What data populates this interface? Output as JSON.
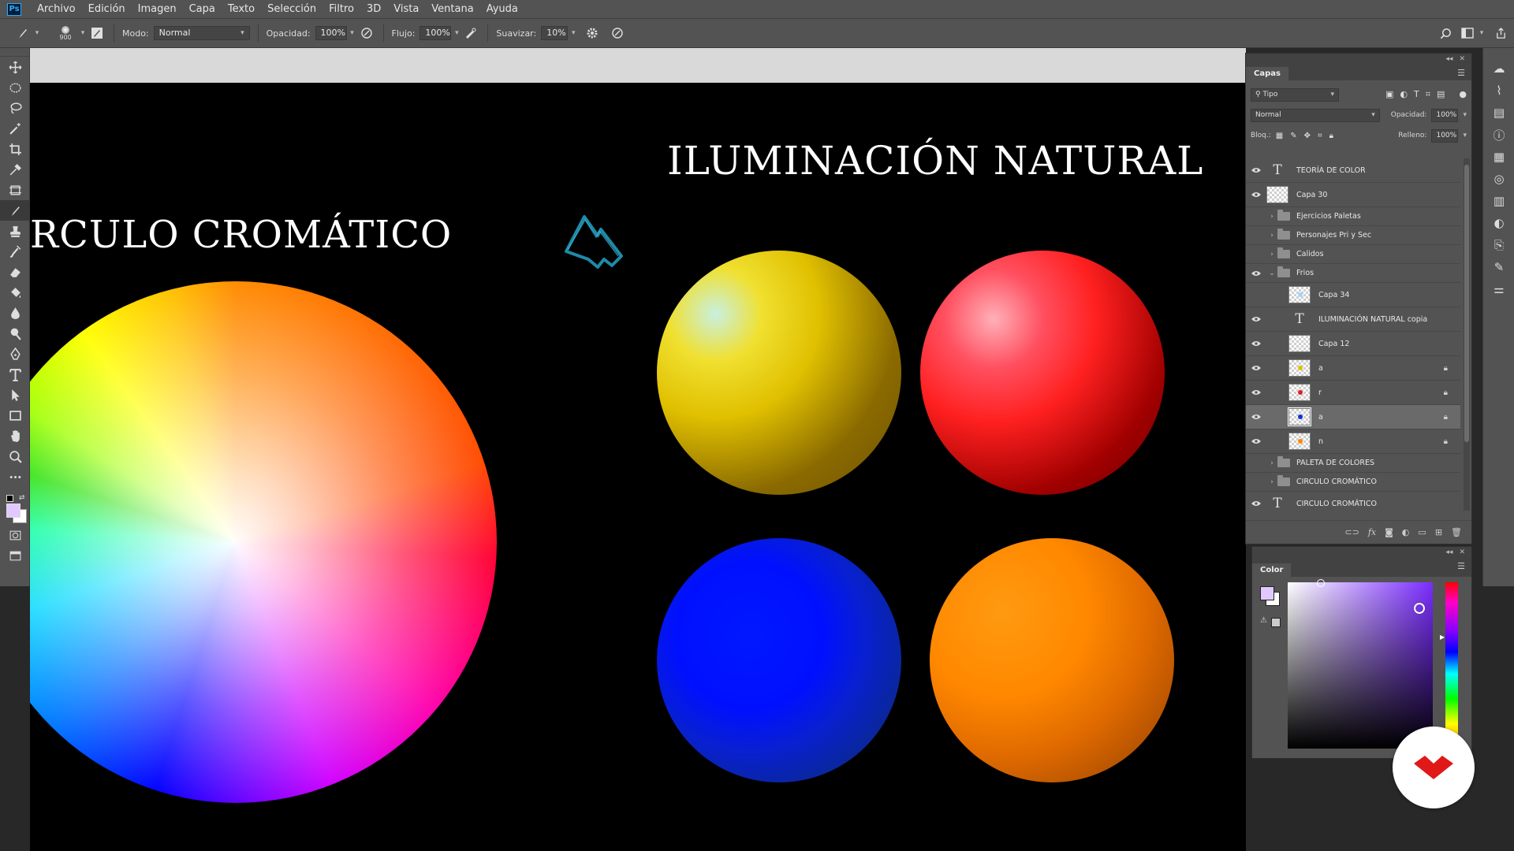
{
  "menubar": {
    "logo": "Ps",
    "items": [
      "Archivo",
      "Edición",
      "Imagen",
      "Capa",
      "Texto",
      "Selección",
      "Filtro",
      "3D",
      "Vista",
      "Ventana",
      "Ayuda"
    ]
  },
  "options": {
    "brush_size": "900",
    "mode_label": "Modo:",
    "mode_value": "Normal",
    "opacity_label": "Opacidad:",
    "opacity_value": "100%",
    "flow_label": "Flujo:",
    "flow_value": "100%",
    "smoothing_label": "Suavizar:",
    "smoothing_value": "10%"
  },
  "canvas": {
    "title_left": "RCULO CROMÁTICO",
    "title_right": "ILUMINACIÓN NATURAL",
    "sphere_colors": [
      "#e0c000",
      "#ff2020",
      "#0010ff",
      "#ff8800"
    ]
  },
  "layers_panel": {
    "tab": "Capas",
    "filter_value": "Tipo",
    "blend_mode": "Normal",
    "opacity_label": "Opacidad:",
    "opacity_value": "100%",
    "lock_label": "Bloq.:",
    "fill_label": "Relleno:",
    "fill_value": "100%",
    "layers": [
      {
        "name": "TEORÍA DE COLOR",
        "kind": "text",
        "visible": true,
        "indent": 0
      },
      {
        "name": "Capa 30",
        "kind": "pixel",
        "visible": true,
        "indent": 0
      },
      {
        "name": "Ejercicios Paletas",
        "kind": "group",
        "visible": false,
        "expanded": false,
        "indent": 0
      },
      {
        "name": "Personajes Pri y Sec",
        "kind": "group",
        "visible": false,
        "expanded": false,
        "indent": 0
      },
      {
        "name": "Calidos",
        "kind": "group",
        "visible": false,
        "expanded": false,
        "indent": 0
      },
      {
        "name": "Frios",
        "kind": "group",
        "visible": true,
        "expanded": true,
        "indent": 0
      },
      {
        "name": "Capa 34",
        "kind": "pixel",
        "visible": false,
        "indent": 1,
        "dot": "#9fd6ff"
      },
      {
        "name": "ILUMINACIÓN NATURAL copia",
        "kind": "text",
        "visible": true,
        "indent": 1
      },
      {
        "name": "Capa 12",
        "kind": "pixel",
        "visible": true,
        "indent": 1
      },
      {
        "name": "a",
        "kind": "pixel",
        "visible": true,
        "indent": 1,
        "locked": true,
        "dot": "#e0c000"
      },
      {
        "name": "r",
        "kind": "pixel",
        "visible": true,
        "indent": 1,
        "locked": true,
        "dot": "#e02020"
      },
      {
        "name": "a",
        "kind": "pixel",
        "visible": true,
        "indent": 1,
        "locked": true,
        "selected": true,
        "dot": "#1030d0"
      },
      {
        "name": "n",
        "kind": "pixel",
        "visible": true,
        "indent": 1,
        "locked": true,
        "dot": "#ff8800"
      },
      {
        "name": "PALETA DE COLORES",
        "kind": "group",
        "visible": false,
        "expanded": false,
        "indent": 0
      },
      {
        "name": "CIRCULO CROMÁTICO",
        "kind": "group",
        "visible": false,
        "expanded": false,
        "indent": 0
      },
      {
        "name": "CIRCULO CROMÁTICO",
        "kind": "text",
        "visible": true,
        "indent": 0
      }
    ]
  },
  "color_panel": {
    "tab": "Color",
    "foreground": "#e1c9ff",
    "background": "#ffffff"
  },
  "tools": [
    "move",
    "marquee",
    "lasso",
    "magic-wand",
    "crop",
    "eyedropper",
    "frame",
    "brush",
    "clone-stamp",
    "history-brush",
    "eraser",
    "paint-bucket",
    "blur",
    "dodge",
    "pen",
    "type",
    "path-select",
    "rectangle",
    "hand",
    "zoom",
    "more"
  ],
  "active_tool": "brush"
}
